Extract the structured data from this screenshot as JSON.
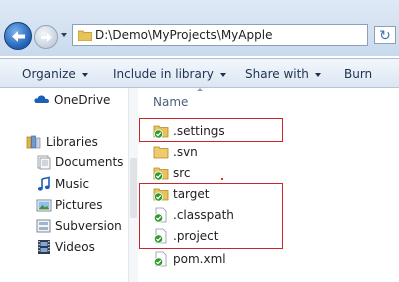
{
  "address_bar": {
    "path": "D:\\Demo\\MyProjects\\MyApple"
  },
  "toolbar": {
    "organize": "Organize",
    "include_in_library": "Include in library",
    "share_with": "Share with",
    "burn": "Burn"
  },
  "nav_pane": {
    "onedrive": "OneDrive",
    "libraries": "Libraries",
    "items": [
      "Documents",
      "Music",
      "Pictures",
      "Subversion",
      "Videos"
    ]
  },
  "content": {
    "column_name": "Name",
    "files": [
      ".settings",
      ".svn",
      "src",
      "target",
      ".classpath",
      ".project",
      "pom.xml"
    ]
  },
  "colors": {
    "highlight": "#c8252d",
    "svn_ok": "#2d9a2d",
    "folder": "#e8c35a"
  },
  "icons": {
    "folder_ok": "folder-with-green-check-icon",
    "folder_plain": "folder-icon",
    "file_ok": "file-with-green-check-icon"
  }
}
